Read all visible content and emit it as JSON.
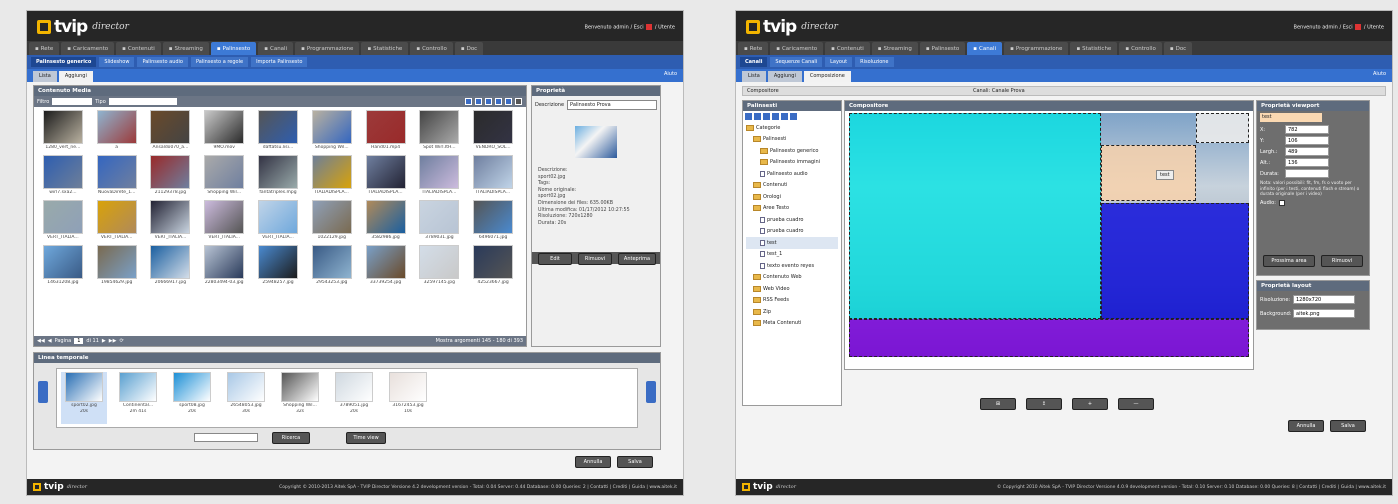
{
  "app": {
    "brand": "tvip",
    "brand_sub": "director"
  },
  "colors": {
    "accent": "#3d7ad6",
    "brand": "#f2b400",
    "header": "#262626"
  },
  "screen1": {
    "welcome": "Benvenuto admin / Esci",
    "welcome_user": "/ Utente",
    "nav": [
      "Rete",
      "Caricamento",
      "Contenuti",
      "Streaming",
      "Palinsesto",
      "Canali",
      "Programmazione",
      "Statistiche",
      "Controllo",
      "Doc"
    ],
    "nav_active": "Palinsesto",
    "subnav": [
      "Palinsesto generico",
      "Slideshow",
      "Palinsesto audio",
      "Palinsesto a regole",
      "Importa Palinsesto"
    ],
    "tabs": [
      "Lista",
      "Aggiungi"
    ],
    "tab_aux": "Aiuto",
    "media_panel": {
      "title": "Contenuto Media",
      "filter_label": "Filtro",
      "type_label": "Tipo",
      "thumbs": [
        "1280_vert_ne...",
        "a",
        "Ansaldo070_a...",
        "9MO.mov",
        "daftatsu.lisi...",
        "Shopping Wil...",
        "Hand01.mp4",
        "Spot Wirl.ItH...",
        "VENDRO_SOL...",
        "wirl7.sxa2...",
        "NuovaDirete_1...",
        "21129378.jpg",
        "Shopping Wil...",
        "fantatriples.mpg",
        "ITALIADISPLA...",
        "ITALIADISPLA...",
        "ITALIADISPLA...",
        "ITALIADISPLA...",
        "VERT_ITALIA...",
        "VERT_ITALIA...",
        "VERT_ITALIA...",
        "VERT_ITALIA...",
        "VERT_ITALIA...",
        "1022129.jpg",
        "3582986.jpg",
        "3789031.jpg",
        "6496071.jpg",
        "14631208.jpg",
        "19854629.jpg",
        "20666917.jpg",
        "22803494-03.jpg",
        "25948257.jpg",
        "29543253.jpg",
        "33739254.jpg",
        "32597145.jpg",
        "42523667.jpg"
      ],
      "pager_label": "Pagina",
      "pager_page": "1",
      "pager_of": "di 11",
      "pager_info": "Mostra argomenti 145 - 180 di 393"
    },
    "props": {
      "title": "Proprietà",
      "desc_label": "Descrizione",
      "desc_value": "Palinsesto Prova",
      "info": [
        "Descrizione:",
        "sport02.jpg",
        "Tags:",
        "Nome originale:",
        "sport02.jpg",
        "Dimensione dei files: 635.00KB",
        "Ultima modifica: 01/17/2012 10:27:55",
        "Risoluzione: 720x1280",
        "Durata: 20s"
      ],
      "buttons": [
        "Edit",
        "Rimuovi",
        "Anteprima"
      ]
    },
    "timeline": {
      "title": "Linea temporale",
      "items": [
        {
          "name": "sport02.jpg",
          "dur": "20s"
        },
        {
          "name": "Continental...",
          "dur": "2m 41s"
        },
        {
          "name": "sport08.jpg",
          "dur": "20s"
        },
        {
          "name": "26548053.jpg",
          "dur": "30s"
        },
        {
          "name": "Shopping Wil...",
          "dur": "32s"
        },
        {
          "name": "3789051.jpg",
          "dur": "20s"
        },
        {
          "name": "31672453.jpg",
          "dur": "10s"
        }
      ],
      "btn_reset": "Ricerca",
      "btn_time": "Time view"
    },
    "actions": [
      "Annulla",
      "Salva"
    ],
    "footer": "Copyright © 2010-2013 Aitek SpA - TVIP Director Versione 4.2 development version - Total: 0.04 Server: 0.44 Database: 0.00 Queries: 2 | Contatti | Crediti | Guida | www.aitek.it"
  },
  "screen2": {
    "welcome": "Benvenuto admin / Esci",
    "welcome_user": "/ Utente",
    "nav": [
      "Rete",
      "Caricamento",
      "Contenuti",
      "Streaming",
      "Palinsesto",
      "Canali",
      "Programmazione",
      "Statistiche",
      "Controllo",
      "Doc"
    ],
    "nav_active": "Canali",
    "subnav": [
      "Canali",
      "Sequenze Canali",
      "Layout",
      "Risoluzione"
    ],
    "tabs": [
      "Lista",
      "Aggiungi",
      "Composizione"
    ],
    "tab_aux": "Aiuto",
    "crumb_left": "Compositore",
    "crumb_center": "Canali: Canale Prova",
    "tree_title": "Palinsesti",
    "tree": [
      {
        "label": "Categorie",
        "lvl": 0,
        "t": "fold"
      },
      {
        "label": "Palinsesti",
        "lvl": 1,
        "t": "fold"
      },
      {
        "label": "Palinsesto generico",
        "lvl": 2,
        "t": "fold"
      },
      {
        "label": "Palinsesto immagini",
        "lvl": 2,
        "t": "fold"
      },
      {
        "label": "Palinsesto audio",
        "lvl": 2,
        "t": "file"
      },
      {
        "label": "Contenuti",
        "lvl": 1,
        "t": "fold"
      },
      {
        "label": "Orologi",
        "lvl": 1,
        "t": "fold"
      },
      {
        "label": "Aree Testo",
        "lvl": 1,
        "t": "fold"
      },
      {
        "label": "prueba cuadro",
        "lvl": 2,
        "t": "file"
      },
      {
        "label": "prueba cuadro",
        "lvl": 2,
        "t": "file"
      },
      {
        "label": "test",
        "lvl": 2,
        "t": "file"
      },
      {
        "label": "test_1",
        "lvl": 2,
        "t": "file"
      },
      {
        "label": "texto evento reyes",
        "lvl": 2,
        "t": "file"
      },
      {
        "label": "Contenuto Web",
        "lvl": 1,
        "t": "fold"
      },
      {
        "label": "Web Video",
        "lvl": 1,
        "t": "fold"
      },
      {
        "label": "RSS Feeds",
        "lvl": 1,
        "t": "fold"
      },
      {
        "label": "Zip",
        "lvl": 1,
        "t": "fold"
      },
      {
        "label": "Meta Contenuti",
        "lvl": 1,
        "t": "fold"
      }
    ],
    "composer_title": "Compositore",
    "region_label": "test",
    "viewport": {
      "title": "Proprietà viewport",
      "name": "test",
      "x": "782",
      "y": "106",
      "w": "489",
      "h": "136",
      "labels": [
        "X:",
        "Y:",
        "Largh.:",
        "Alt.:",
        "Durata:"
      ],
      "note": "Nota: valori possibili: fit, fm, fs o vuoto per infinito (per i testi, contenuti flash e stream) o durata originale (per i video)",
      "audio_label": "Audio:",
      "btn_next": "Prossima area",
      "btn_remove": "Rimuovi"
    },
    "layout": {
      "title": "Proprietà layout",
      "res_label": "Risoluzione:",
      "res_value": "1280x720",
      "bg_label": "Background:",
      "bg_value": "aitek.png"
    },
    "tools": [
      "⊞",
      "↥",
      "+",
      "—"
    ],
    "actions": [
      "Annulla",
      "Salva"
    ],
    "footer": "© Copyright 2010 Aitek SpA - TVIP Director Versione 4.0.9 development version - Total: 0.10 Server: 0.10 Database: 0.00 Queries: 8 | Contatti | Crediti | Guida | www.aitek.it"
  }
}
